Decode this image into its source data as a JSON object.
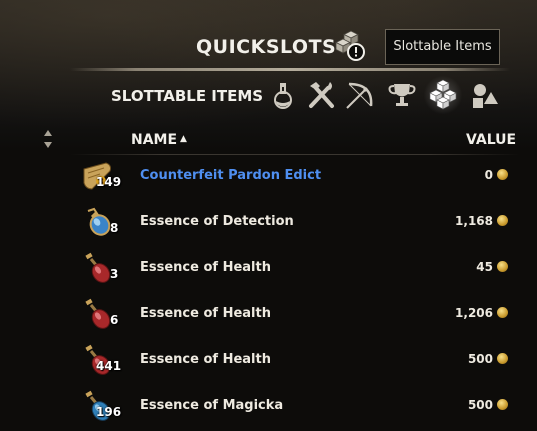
{
  "header": {
    "title": "QUICKSLOTS",
    "icon": "cubes-alert-icon",
    "tooltip": "Slottable Items"
  },
  "filters": {
    "label": "SLOTTABLE ITEMS",
    "icons": [
      "potion-icon",
      "tools-icon",
      "bow-icon",
      "trophy-icon",
      "cubes-icon",
      "shapes-icon"
    ],
    "active": "cubes-icon"
  },
  "columns": {
    "name": "NAME",
    "name_sort": "▲",
    "value": "VALUE"
  },
  "items": [
    {
      "count": "149",
      "name": "Counterfeit Pardon Edict",
      "value": "0",
      "icon": "scroll-icon",
      "color": "#4f8ff0"
    },
    {
      "count": "8",
      "name": "Essence of Detection",
      "value": "1,168",
      "icon": "blue-potion-icon",
      "color": "#eeeae0"
    },
    {
      "count": "3",
      "name": "Essence of Health",
      "value": "45",
      "icon": "red-potion-icon",
      "color": "#eeeae0"
    },
    {
      "count": "6",
      "name": "Essence of Health",
      "value": "1,206",
      "icon": "red-potion-icon",
      "color": "#eeeae0"
    },
    {
      "count": "441",
      "name": "Essence of Health",
      "value": "500",
      "icon": "red-potion-icon",
      "color": "#eeeae0"
    },
    {
      "count": "196",
      "name": "Essence of Magicka",
      "value": "500",
      "icon": "blue-potion-icon",
      "color": "#eeeae0"
    }
  ],
  "colors": {
    "accent_blue": "#4f8ff0",
    "gold": "#c99a2c",
    "text": "#eeeae0"
  }
}
